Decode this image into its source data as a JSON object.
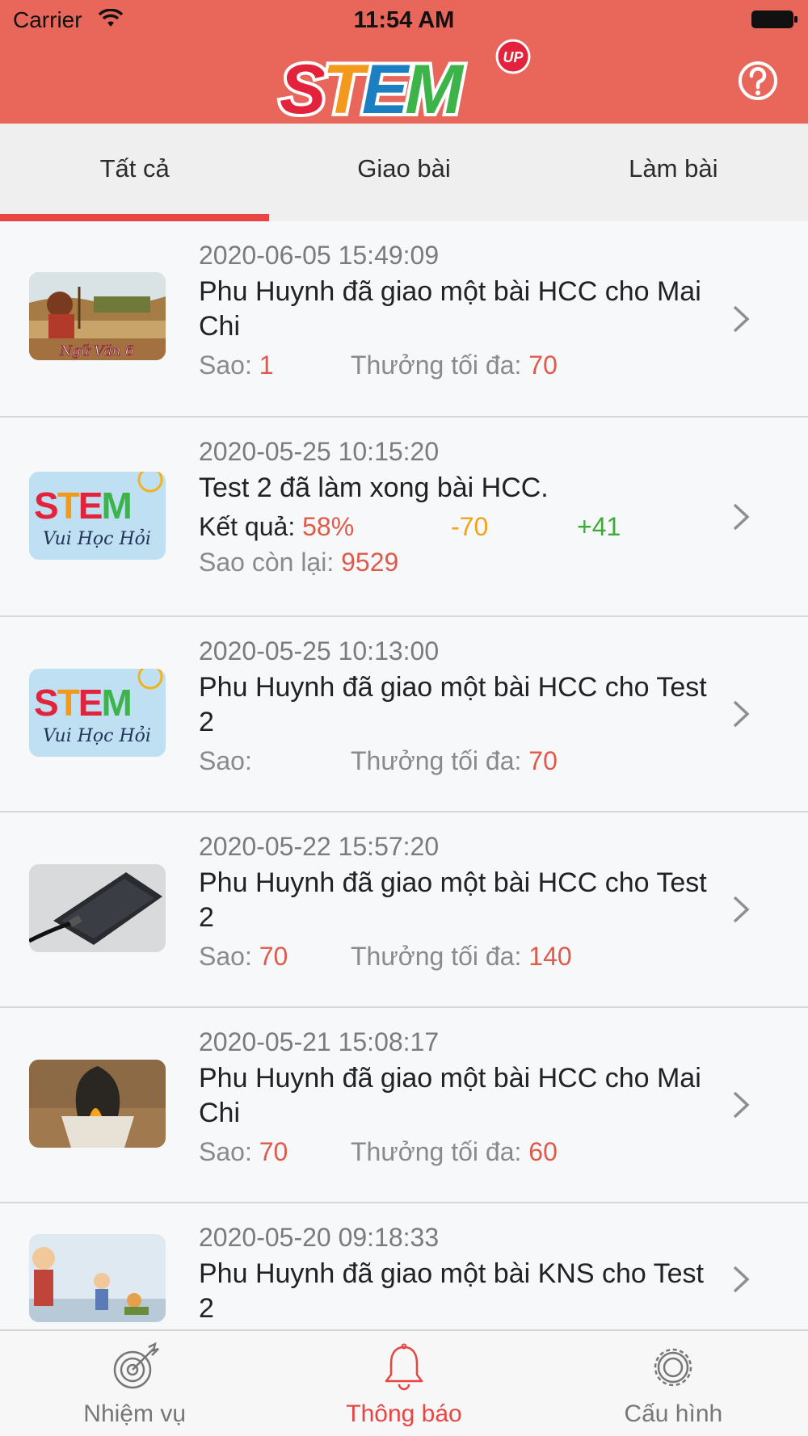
{
  "status_bar": {
    "carrier": "Carrier",
    "time": "11:54 AM"
  },
  "header": {
    "logo_text": "STEM",
    "logo_badge": "UP",
    "help_icon": "help-circle-icon"
  },
  "tabs": [
    {
      "label": "Tất cả",
      "active": true
    },
    {
      "label": "Giao bài",
      "active": false
    },
    {
      "label": "Làm bài",
      "active": false
    }
  ],
  "notifications": [
    {
      "timestamp": "2020-06-05 15:49:09",
      "title": "Phu Huynh đã giao một bài HCC cho Mai Chi",
      "stars_label": "Sao:",
      "stars_value": "1",
      "max_reward_label": "Thưởng tối đa:",
      "max_reward_value": "70",
      "thumbnail": "literature-drawing"
    },
    {
      "timestamp": "2020-05-25 10:15:20",
      "title": "Test 2  đã làm xong bài HCC.",
      "result_label": "Kết quả:",
      "result_value": "58%",
      "result_minus": "-70",
      "result_plus": "+41",
      "remaining_label": "Sao còn lại:",
      "remaining_value": "9529",
      "thumbnail": "stem-logo"
    },
    {
      "timestamp": "2020-05-25 10:13:00",
      "title": "Phu Huynh đã giao một bài HCC cho Test 2",
      "stars_label": "Sao:",
      "stars_value": "",
      "max_reward_label": "Thưởng tối đa:",
      "max_reward_value": "70",
      "thumbnail": "stem-logo"
    },
    {
      "timestamp": "2020-05-22 15:57:20",
      "title": "Phu Huynh đã giao một bài HCC cho Test 2",
      "stars_label": "Sao:",
      "stars_value": "70",
      "max_reward_label": "Thưởng tối đa:",
      "max_reward_value": "140",
      "thumbnail": "phone-charging"
    },
    {
      "timestamp": "2020-05-21 15:08:17",
      "title": "Phu Huynh đã giao một bài HCC cho Mai Chi",
      "stars_label": "Sao:",
      "stars_value": "70",
      "max_reward_label": "Thưởng tối đa:",
      "max_reward_value": "60",
      "thumbnail": "burning-cup"
    },
    {
      "timestamp": "2020-05-20 09:18:33",
      "title": "Phu Huynh đã giao một bài KNS cho Test 2",
      "thumbnail": "cartoon-scene"
    }
  ],
  "stem_thumb_caption": "Vui Học Hỏi",
  "thumb1_caption": "Ngữ Văn 6",
  "bottom_tabs": [
    {
      "label": "Nhiệm vụ",
      "icon": "target-icon",
      "active": false
    },
    {
      "label": "Thông báo",
      "icon": "bell-icon",
      "active": true
    },
    {
      "label": "Cấu hình",
      "icon": "gear-icon",
      "active": false
    }
  ],
  "colors": {
    "header": "#e8665a",
    "accent": "#e84545",
    "value_red": "#e05a4a",
    "value_orange": "#f2a21b",
    "value_green": "#3faa3a"
  }
}
